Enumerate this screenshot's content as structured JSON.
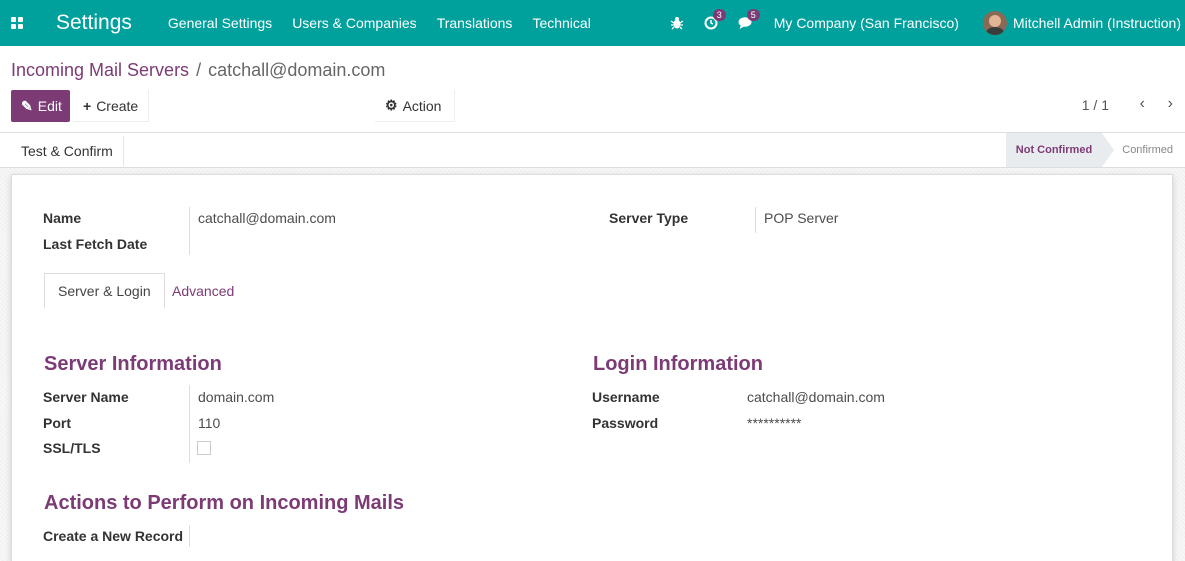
{
  "navbar": {
    "brand": "Settings",
    "menu": [
      "General Settings",
      "Users & Companies",
      "Translations",
      "Technical"
    ],
    "activity_count": "3",
    "message_count": "5",
    "company": "My Company (San Francisco)",
    "user": "Mitchell Admin (Instruction)",
    "accent": "#00a09d"
  },
  "breadcrumb": {
    "parent": "Incoming Mail Servers",
    "separator": "/",
    "current": "catchall@domain.com"
  },
  "toolbar": {
    "edit_label": "Edit",
    "create_label": "Create",
    "action_label": "Action",
    "pager": "1 / 1"
  },
  "statusbar": {
    "test_label": "Test & Confirm",
    "stages": [
      "Not Confirmed",
      "Confirmed"
    ],
    "active_stage": "Not Confirmed"
  },
  "form": {
    "name_label": "Name",
    "name_value": "catchall@domain.com",
    "last_fetch_label": "Last Fetch Date",
    "last_fetch_value": "",
    "server_type_label": "Server Type",
    "server_type_value": "POP Server",
    "tabs": [
      "Server & Login",
      "Advanced"
    ],
    "server_info_title": "Server Information",
    "server_name_label": "Server Name",
    "server_name_value": "domain.com",
    "port_label": "Port",
    "port_value": "110",
    "ssl_label": "SSL/TLS",
    "ssl_checked": false,
    "login_info_title": "Login Information",
    "username_label": "Username",
    "username_value": "catchall@domain.com",
    "password_label": "Password",
    "password_value": "**********",
    "actions_title": "Actions to Perform on Incoming Mails",
    "create_record_label": "Create a New Record"
  },
  "colors": {
    "primary": "#7c3b75",
    "navbar": "#00a09d"
  }
}
